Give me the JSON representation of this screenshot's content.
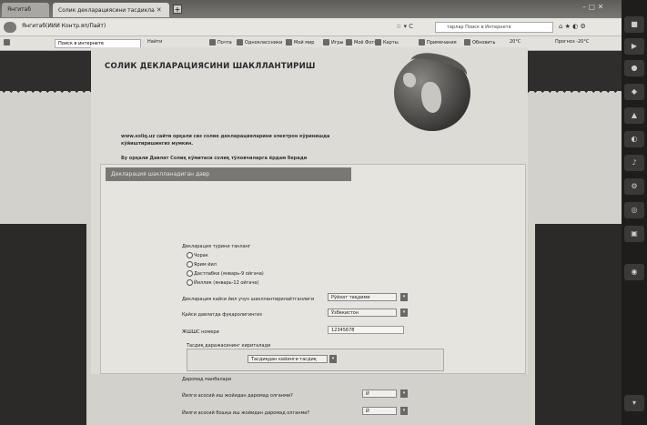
{
  "browser": {
    "tabs": [
      {
        "label": "Янгитаб"
      },
      {
        "label": "Солик декларациясини тасдикла"
      }
    ],
    "url": "Янгитаб(ИИИ Контр.яп/Пайт)",
    "search_placeholder": "тарлар Поиск в Интернете",
    "search_engine": "Поиск в интернете",
    "bookmarks": [
      "Найти",
      "Почта",
      "Одноклассники",
      "Мой мир",
      "Игры",
      "Моё Фото",
      "Карты"
    ],
    "right_items": [
      "Примечания",
      "Обновить",
      "20°С",
      "Прогноз -20°С"
    ]
  },
  "page": {
    "title": "СОЛИК ДЕКЛАРАЦИЯСИНИ ШАКЛЛАНТИРИШ",
    "desc1": "www.soliq.uz сайти орқали сиз солик декларацияларини электрон кўринишда кўйиштиришингиз мумкин.",
    "desc2": "Бу орқали Давлат Солиқ кўмитаси солиқ тўловчиларга ёрдам беради",
    "form_header": "Декларация шаклланадиган давр",
    "period_label": "Декларация турини танланг",
    "periods": [
      "Чорак",
      "Ярим йил",
      "Дастлабки (январь-9 ойгача)",
      "Йиллик (январь-12 ойгача)"
    ],
    "field1_label": "Декларация кайси йил учун шакллантирилаётганлиги",
    "field1_value": "Рўйхат тақдими",
    "field2_label": "Қайси давлатда фуқаролигингиз",
    "field2_value": "Ўзбекистон",
    "stir_label": "ЖШШС номери",
    "stir_value": "12345678",
    "subsection_label": "Тасдиқ даражасининг кириталади",
    "subsection_select": "Тасдиқдан кейинги тасдиқ",
    "income_label": "Даромад манбалари",
    "q1_label": "Йилги асосий иш жойидан даромад олганми?",
    "q1_value": "Й",
    "q2_label": "Йилги асосий бошқа иш жойидан даромад олганми?",
    "q2_value": "Й"
  },
  "colors": {
    "band": "#2f2e2c",
    "paper": "#dddbd6",
    "header_bar": "#7a7874"
  }
}
